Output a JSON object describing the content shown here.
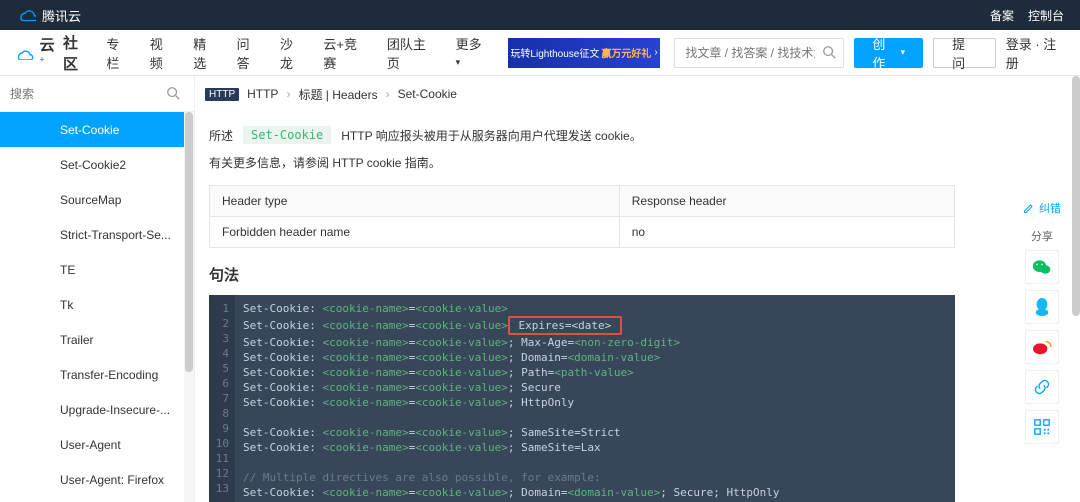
{
  "topbar": {
    "brand": "腾讯云",
    "links": [
      "备案",
      "控制台"
    ]
  },
  "navbar": {
    "community": "社区",
    "items": [
      "专栏",
      "视频",
      "精选",
      "问答",
      "沙龙",
      "云+竞赛",
      "团队主页",
      "更多"
    ],
    "banner_main": "玩转Lighthouse征文",
    "banner_sub": "赢万元好礼",
    "search_placeholder": "找文章 / 找答案 / 找技术大牛",
    "create": "创作",
    "ask": "提问",
    "auth": "登录 · 注册"
  },
  "sidebar": {
    "search_placeholder": "搜索",
    "items": [
      "Set-Cookie",
      "Set-Cookie2",
      "SourceMap",
      "Strict-Transport-Se...",
      "TE",
      "Tk",
      "Trailer",
      "Transfer-Encoding",
      "Upgrade-Insecure-...",
      "User-Agent",
      "User-Agent: Firefox"
    ],
    "active_index": 0
  },
  "breadcrumb": {
    "badge": "HTTP",
    "items": [
      "HTTP",
      "标题 | Headers",
      "Set-Cookie"
    ]
  },
  "content": {
    "desc_label": "所述",
    "desc_code": "Set-Cookie",
    "desc_text": "HTTP 响应报头被用于从服务器向用户代理发送 cookie。",
    "subdesc": "有关更多信息，请参阅 HTTP cookie 指南。",
    "table": {
      "h1": "Header type",
      "h2": "Response header",
      "r1": "Forbidden header name",
      "r2": "no"
    },
    "syntax_title": "句法",
    "code": {
      "lines": [
        [
          [
            "kw",
            "Set-Cookie: "
          ],
          [
            "var",
            "<cookie-name>"
          ],
          [
            "kw",
            "="
          ],
          [
            "var",
            "<cookie-value>"
          ]
        ],
        [
          [
            "kw",
            "Set-Cookie: "
          ],
          [
            "var",
            "<cookie-name>"
          ],
          [
            "kw",
            "="
          ],
          [
            "var",
            "<cookie-value>"
          ],
          [
            "hl",
            " Expires=<date> "
          ]
        ],
        [
          [
            "kw",
            "Set-Cookie: "
          ],
          [
            "var",
            "<cookie-name>"
          ],
          [
            "kw",
            "="
          ],
          [
            "var",
            "<cookie-value>"
          ],
          [
            "kw",
            "; Max-Age="
          ],
          [
            "var",
            "<non-zero-digit>"
          ]
        ],
        [
          [
            "kw",
            "Set-Cookie: "
          ],
          [
            "var",
            "<cookie-name>"
          ],
          [
            "kw",
            "="
          ],
          [
            "var",
            "<cookie-value>"
          ],
          [
            "kw",
            "; Domain="
          ],
          [
            "var",
            "<domain-value>"
          ]
        ],
        [
          [
            "kw",
            "Set-Cookie: "
          ],
          [
            "var",
            "<cookie-name>"
          ],
          [
            "kw",
            "="
          ],
          [
            "var",
            "<cookie-value>"
          ],
          [
            "kw",
            "; Path="
          ],
          [
            "var",
            "<path-value>"
          ]
        ],
        [
          [
            "kw",
            "Set-Cookie: "
          ],
          [
            "var",
            "<cookie-name>"
          ],
          [
            "kw",
            "="
          ],
          [
            "var",
            "<cookie-value>"
          ],
          [
            "kw",
            "; Secure"
          ]
        ],
        [
          [
            "kw",
            "Set-Cookie: "
          ],
          [
            "var",
            "<cookie-name>"
          ],
          [
            "kw",
            "="
          ],
          [
            "var",
            "<cookie-value>"
          ],
          [
            "kw",
            "; HttpOnly"
          ]
        ],
        [],
        [
          [
            "kw",
            "Set-Cookie: "
          ],
          [
            "var",
            "<cookie-name>"
          ],
          [
            "kw",
            "="
          ],
          [
            "var",
            "<cookie-value>"
          ],
          [
            "kw",
            "; SameSite=Strict"
          ]
        ],
        [
          [
            "kw",
            "Set-Cookie: "
          ],
          [
            "var",
            "<cookie-name>"
          ],
          [
            "kw",
            "="
          ],
          [
            "var",
            "<cookie-value>"
          ],
          [
            "kw",
            "; SameSite=Lax"
          ]
        ],
        [],
        [
          [
            "cm",
            "// Multiple directives are also possible, for example:"
          ]
        ],
        [
          [
            "kw",
            "Set-Cookie: "
          ],
          [
            "var",
            "<cookie-name>"
          ],
          [
            "kw",
            "="
          ],
          [
            "var",
            "<cookie-value>"
          ],
          [
            "kw",
            "; Domain="
          ],
          [
            "var",
            "<domain-value>"
          ],
          [
            "kw",
            "; Secure; HttpOnly"
          ]
        ]
      ]
    }
  },
  "side_actions": {
    "report": "纠错",
    "share": "分享"
  }
}
